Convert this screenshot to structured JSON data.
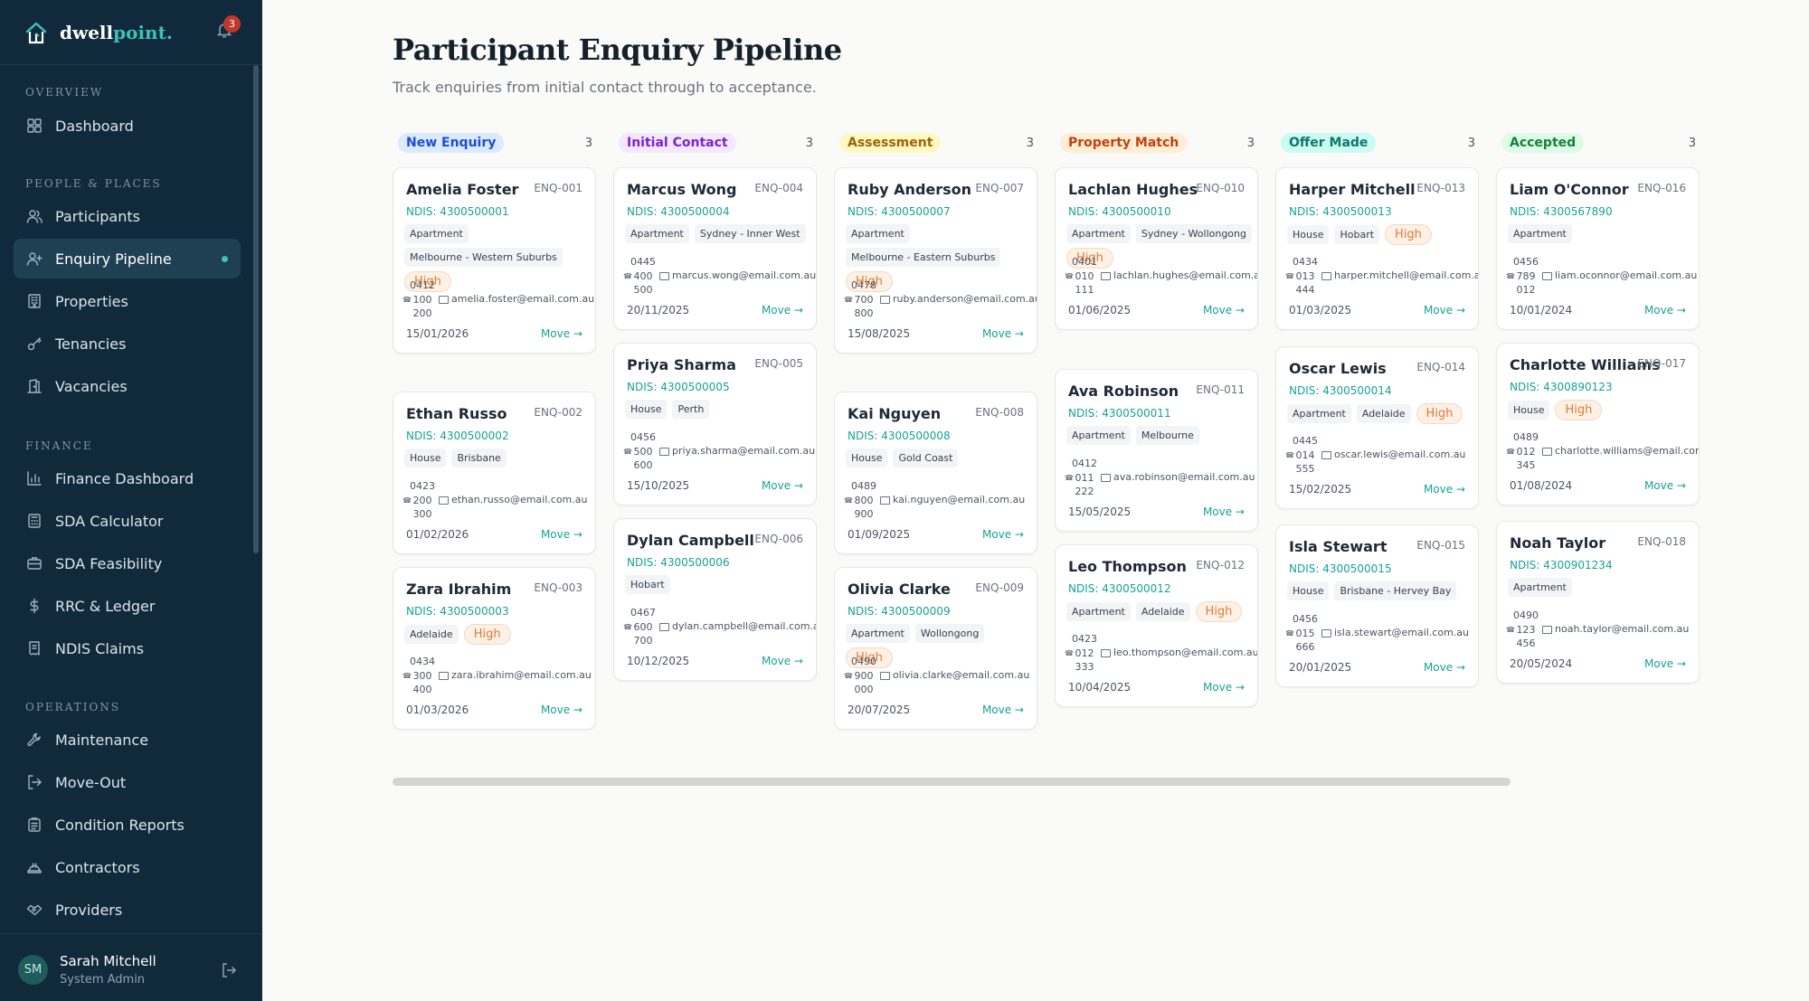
{
  "app": {
    "logo_main": "dwell",
    "logo_accent": "point.",
    "notification_count": "3"
  },
  "sidebar": {
    "groups": [
      {
        "label": "OVERVIEW",
        "items": [
          {
            "label": "Dashboard",
            "icon": "grid-icon"
          }
        ]
      },
      {
        "label": "PEOPLE & PLACES",
        "items": [
          {
            "label": "Participants",
            "icon": "users-icon"
          },
          {
            "label": "Enquiry Pipeline",
            "icon": "user-plus-icon",
            "active": true
          },
          {
            "label": "Properties",
            "icon": "building-icon"
          },
          {
            "label": "Tenancies",
            "icon": "key-icon"
          },
          {
            "label": "Vacancies",
            "icon": "door-icon"
          }
        ]
      },
      {
        "label": "FINANCE",
        "items": [
          {
            "label": "Finance Dashboard",
            "icon": "bar-chart-icon"
          },
          {
            "label": "SDA Calculator",
            "icon": "calculator-icon"
          },
          {
            "label": "SDA Feasibility",
            "icon": "briefcase-icon"
          },
          {
            "label": "RRC & Ledger",
            "icon": "dollar-icon"
          },
          {
            "label": "NDIS Claims",
            "icon": "receipt-icon"
          }
        ]
      },
      {
        "label": "OPERATIONS",
        "items": [
          {
            "label": "Maintenance",
            "icon": "wrench-icon"
          },
          {
            "label": "Move-Out",
            "icon": "exit-icon"
          },
          {
            "label": "Condition Reports",
            "icon": "clipboard-icon"
          },
          {
            "label": "Contractors",
            "icon": "hardhat-icon"
          },
          {
            "label": "Providers",
            "icon": "handshake-icon"
          }
        ]
      }
    ],
    "user": {
      "initials": "SM",
      "name": "Sarah Mitchell",
      "role": "System Admin"
    }
  },
  "header": {
    "title": "Participant Enquiry Pipeline",
    "subtitle": "Track enquiries from initial contact through to acceptance."
  },
  "colors": {
    "sidebar_bg": "#102a3c",
    "accent": "#3cc3b1",
    "link": "#16a394",
    "high_priority": "#e07b39"
  },
  "columns": [
    {
      "stage": "New Enquiry",
      "count": "3",
      "pill_bg": "#dbeafe",
      "pill_fg": "#1d4ed8",
      "cards": [
        {
          "name": "Amelia Foster",
          "id": "ENQ-001",
          "ndis": "NDIS: 4300500001",
          "tags": [
            "Apartment",
            "Melbourne - Western Suburbs"
          ],
          "high": true,
          "phone": [
            "0412",
            "100",
            "200"
          ],
          "email": "amelia.foster@email.com.au",
          "date": "15/01/2026",
          "move": "Move →"
        },
        {
          "name": "Ethan Russo",
          "id": "ENQ-002",
          "ndis": "NDIS: 4300500002",
          "tags": [
            "House",
            "Brisbane"
          ],
          "high": false,
          "phone": [
            "0423",
            "200",
            "300"
          ],
          "email": "ethan.russo@email.com.au",
          "date": "01/02/2026",
          "move": "Move →"
        },
        {
          "name": "Zara Ibrahim",
          "id": "ENQ-003",
          "ndis": "NDIS: 4300500003",
          "tags": [
            "Adelaide"
          ],
          "high": true,
          "phone": [
            "0434",
            "300",
            "400"
          ],
          "email": "zara.ibrahim@email.com.au",
          "date": "01/03/2026",
          "move": "Move →"
        }
      ]
    },
    {
      "stage": "Initial Contact",
      "count": "3",
      "pill_bg": "#f3e8ff",
      "pill_fg": "#7e22ce",
      "cards": [
        {
          "name": "Marcus Wong",
          "id": "ENQ-004",
          "ndis": "NDIS: 4300500004",
          "tags": [
            "Apartment",
            "Sydney - Inner West"
          ],
          "high": false,
          "phone": [
            "0445",
            "400",
            "500"
          ],
          "email": "marcus.wong@email.com.au",
          "date": "20/11/2025",
          "move": "Move →"
        },
        {
          "name": "Priya Sharma",
          "id": "ENQ-005",
          "ndis": "NDIS: 4300500005",
          "tags": [
            "House",
            "Perth"
          ],
          "high": false,
          "phone": [
            "0456",
            "500",
            "600"
          ],
          "email": "priya.sharma@email.com.au",
          "date": "15/10/2025",
          "move": "Move →"
        },
        {
          "name": "Dylan Campbell",
          "id": "ENQ-006",
          "ndis": "NDIS: 4300500006",
          "tags": [
            "Hobart"
          ],
          "high": false,
          "phone": [
            "0467",
            "600",
            "700"
          ],
          "email": "dylan.campbell@email.com.au",
          "date": "10/12/2025",
          "move": "Move →"
        }
      ]
    },
    {
      "stage": "Assessment",
      "count": "3",
      "pill_bg": "#fef9c3",
      "pill_fg": "#a16207",
      "cards": [
        {
          "name": "Ruby Anderson",
          "id": "ENQ-007",
          "ndis": "NDIS: 4300500007",
          "tags": [
            "Apartment",
            "Melbourne - Eastern Suburbs"
          ],
          "high": true,
          "phone": [
            "0478",
            "700",
            "800"
          ],
          "email": "ruby.anderson@email.com.au",
          "date": "15/08/2025",
          "move": "Move →"
        },
        {
          "name": "Kai Nguyen",
          "id": "ENQ-008",
          "ndis": "NDIS: 4300500008",
          "tags": [
            "House",
            "Gold Coast"
          ],
          "high": false,
          "phone": [
            "0489",
            "800",
            "900"
          ],
          "email": "kai.nguyen@email.com.au",
          "date": "01/09/2025",
          "move": "Move →"
        },
        {
          "name": "Olivia Clarke",
          "id": "ENQ-009",
          "ndis": "NDIS: 4300500009",
          "tags": [
            "Apartment",
            "Wollongong"
          ],
          "high": true,
          "phone": [
            "0490",
            "900",
            "000"
          ],
          "email": "olivia.clarke@email.com.au",
          "date": "20/07/2025",
          "move": "Move →"
        }
      ]
    },
    {
      "stage": "Property Match",
      "count": "3",
      "pill_bg": "#ffedd5",
      "pill_fg": "#c2410c",
      "cards": [
        {
          "name": "Lachlan Hughes",
          "id": "ENQ-010",
          "ndis": "NDIS: 4300500010",
          "tags": [
            "Apartment",
            "Sydney - Wollongong"
          ],
          "high": true,
          "phone": [
            "0401",
            "010",
            "111"
          ],
          "email": "lachlan.hughes@email.com.au",
          "date": "01/06/2025",
          "move": "Move →"
        },
        {
          "name": "Ava Robinson",
          "id": "ENQ-011",
          "ndis": "NDIS: 4300500011",
          "tags": [
            "Apartment",
            "Melbourne"
          ],
          "high": false,
          "phone": [
            "0412",
            "011",
            "222"
          ],
          "email": "ava.robinson@email.com.au",
          "date": "15/05/2025",
          "move": "Move →"
        },
        {
          "name": "Leo Thompson",
          "id": "ENQ-012",
          "ndis": "NDIS: 4300500012",
          "tags": [
            "Apartment",
            "Adelaide"
          ],
          "high": true,
          "phone": [
            "0423",
            "012",
            "333"
          ],
          "email": "leo.thompson@email.com.au",
          "date": "10/04/2025",
          "move": "Move →"
        }
      ]
    },
    {
      "stage": "Offer Made",
      "count": "3",
      "pill_bg": "#ccfbf1",
      "pill_fg": "#0f766e",
      "cards": [
        {
          "name": "Harper Mitchell",
          "id": "ENQ-013",
          "ndis": "NDIS: 4300500013",
          "tags": [
            "House",
            "Hobart"
          ],
          "high": true,
          "phone": [
            "0434",
            "013",
            "444"
          ],
          "email": "harper.mitchell@email.com.au",
          "date": "01/03/2025",
          "move": "Move →"
        },
        {
          "name": "Oscar Lewis",
          "id": "ENQ-014",
          "ndis": "NDIS: 4300500014",
          "tags": [
            "Apartment",
            "Adelaide"
          ],
          "high": true,
          "phone": [
            "0445",
            "014",
            "555"
          ],
          "email": "oscar.lewis@email.com.au",
          "date": "15/02/2025",
          "move": "Move →"
        },
        {
          "name": "Isla Stewart",
          "id": "ENQ-015",
          "ndis": "NDIS: 4300500015",
          "tags": [
            "House",
            "Brisbane - Hervey Bay"
          ],
          "high": false,
          "phone": [
            "0456",
            "015",
            "666"
          ],
          "email": "isla.stewart@email.com.au",
          "date": "20/01/2025",
          "move": "Move →"
        }
      ]
    },
    {
      "stage": "Accepted",
      "count": "3",
      "pill_bg": "#dcfce7",
      "pill_fg": "#15803d",
      "cards": [
        {
          "name": "Liam O'Connor",
          "id": "ENQ-016",
          "ndis": "NDIS: 4300567890",
          "tags": [
            "Apartment"
          ],
          "high": false,
          "phone": [
            "0456",
            "789",
            "012"
          ],
          "email": "liam.oconnor@email.com.au",
          "date": "10/01/2024",
          "move": "Move →"
        },
        {
          "name": "Charlotte Williams",
          "id": "ENQ-017",
          "ndis": "NDIS: 4300890123",
          "tags": [
            "House"
          ],
          "high": true,
          "phone": [
            "0489",
            "012",
            "345"
          ],
          "email": "charlotte.williams@email.com.au",
          "date": "01/08/2024",
          "move": "Move →"
        },
        {
          "name": "Noah Taylor",
          "id": "ENQ-018",
          "ndis": "NDIS: 4300901234",
          "tags": [
            "Apartment"
          ],
          "high": false,
          "phone": [
            "0490",
            "123",
            "456"
          ],
          "email": "noah.taylor@email.com.au",
          "date": "20/05/2024",
          "move": "Move →"
        }
      ]
    }
  ],
  "labels": {
    "high": "High"
  }
}
